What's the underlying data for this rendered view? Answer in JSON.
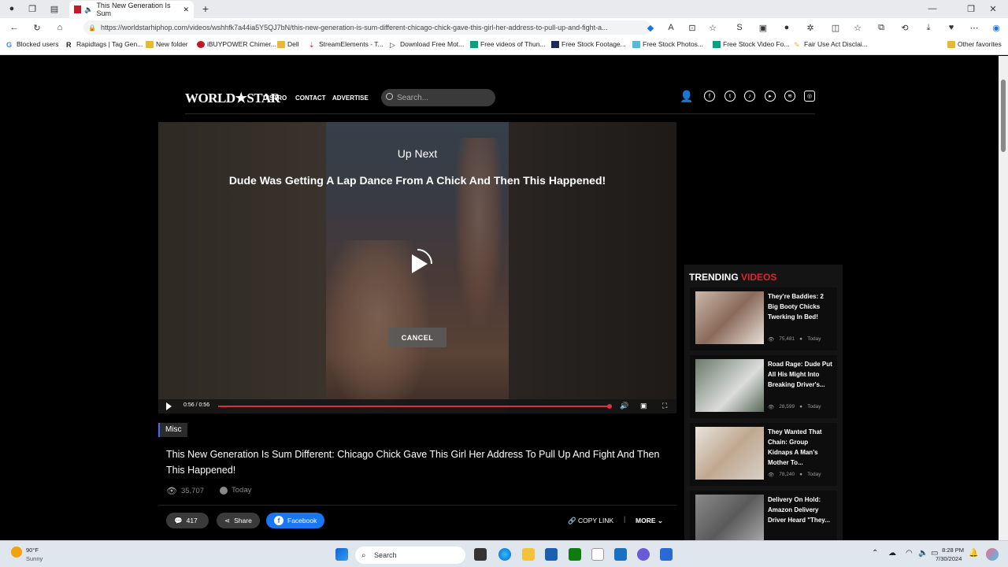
{
  "browser": {
    "tab_title": "This New Generation Is Sum",
    "url": "https://worldstarhiphop.com/videos/wshhfk7a44ia5Y5QJ7bN/this-new-generation-is-sum-different-chicago-chick-gave-this-girl-her-address-to-pull-up-and-fight-a...",
    "favorites": [
      {
        "label": "Blocked users"
      },
      {
        "label": "Rapidtags | Tag Gen..."
      },
      {
        "label": "New folder"
      },
      {
        "label": "iBUYPOWER Chimer..."
      },
      {
        "label": "Dell"
      },
      {
        "label": "StreamElements - T..."
      },
      {
        "label": "Download Free Mot..."
      },
      {
        "label": "Free videos of Thun..."
      },
      {
        "label": "Free Stock Footage..."
      },
      {
        "label": "Free Stock Photos..."
      },
      {
        "label": "Free Stock Video Fo..."
      },
      {
        "label": "Fair Use Act Disclai..."
      }
    ],
    "other_favorites": "Other favorites"
  },
  "site": {
    "logo": "WORLD★STAR",
    "nav": [
      "DISTRO",
      "CONTACT",
      "ADVERTISE"
    ],
    "search_placeholder": "Search..."
  },
  "player": {
    "up_next_label": "Up Next",
    "next_title": "Dude Was Getting A Lap Dance From A Chick And Then This Happened!",
    "cancel_label": "CANCEL",
    "time": "0:56 / 0:56",
    "progress": 1.0
  },
  "video_info": {
    "category": "Misc",
    "title": "This New Generation Is Sum Different: Chicago Chick Gave This Girl Her Address To Pull Up And Fight And Then This Happened!",
    "views": "35,707",
    "date": "Today",
    "comments": "417",
    "share_label": "Share",
    "facebook_label": "Facebook",
    "copy_link_label": "COPY LINK",
    "more_label": "MORE"
  },
  "trending": {
    "heading_1": "TRENDING",
    "heading_2": "VIDEOS",
    "items": [
      {
        "title": "They're Baddies: 2 Big Booty Chicks Twerking In Bed!",
        "views": "75,481",
        "date": "Today"
      },
      {
        "title": "Road Rage: Dude Put All His Might Into Breaking Driver's...",
        "views": "28,599",
        "date": "Today"
      },
      {
        "title": "They Wanted That Chain: Group Kidnaps A Man's Mother To...",
        "views": "78,240",
        "date": "Today"
      },
      {
        "title": "Delivery On Hold: Amazon Delivery Driver Heard \"They...",
        "views": "",
        "date": ""
      }
    ]
  },
  "taskbar": {
    "weather_temp": "90°F",
    "weather_desc": "Sunny",
    "search_label": "Search",
    "time": "8:28 PM",
    "date": "7/30/2024"
  },
  "colors": {
    "accent_red": "#e0242f",
    "progress_red": "#d9313d",
    "facebook_blue": "#1877f2"
  }
}
